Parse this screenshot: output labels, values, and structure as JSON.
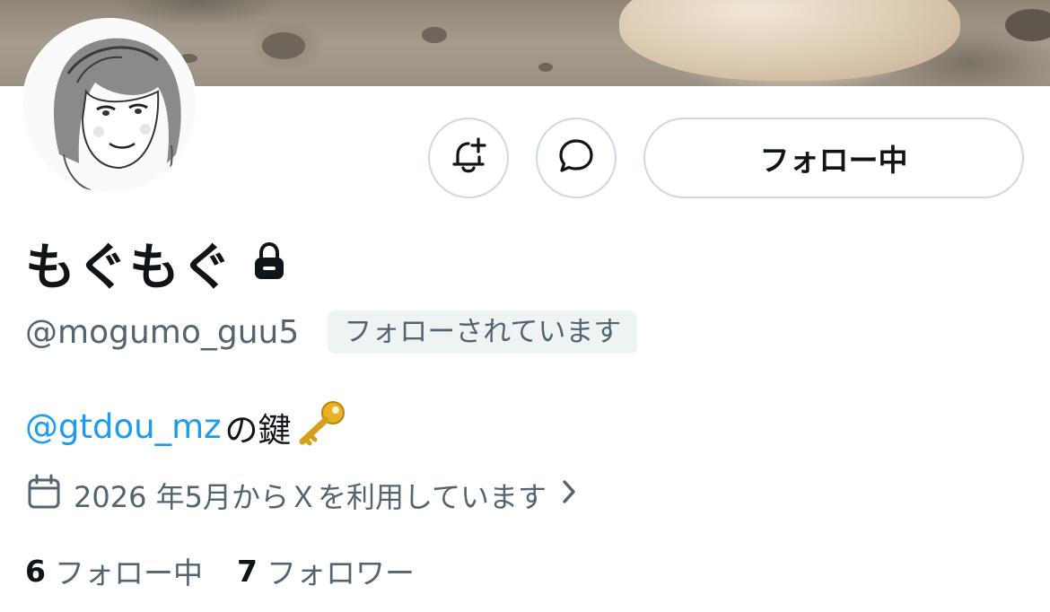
{
  "profile": {
    "display_name": "もぐもぐ",
    "handle": "@mogumo_guu5",
    "follows_you": "フォローされています",
    "bio_mention": "@gtdou_mz",
    "bio_text": "の鍵",
    "joined": "2026 年5月からＸを利用しています",
    "following_count": "6",
    "following_label": "フォロー中",
    "followers_count": "7",
    "followers_label": "フォロワー"
  },
  "actions": {
    "follow_button_label": "フォロー中"
  },
  "icons": {
    "notification": "bell-plus-icon",
    "message": "chat-bubble-icon",
    "locked": "lock-icon",
    "key": "key-emoji-icon",
    "calendar": "calendar-icon",
    "chevron": "chevron-right-icon"
  },
  "colors": {
    "mention": "#1d9bf0",
    "secondary_text": "#536471",
    "border": "#cfd9de",
    "badge_bg": "#eff3f4"
  }
}
